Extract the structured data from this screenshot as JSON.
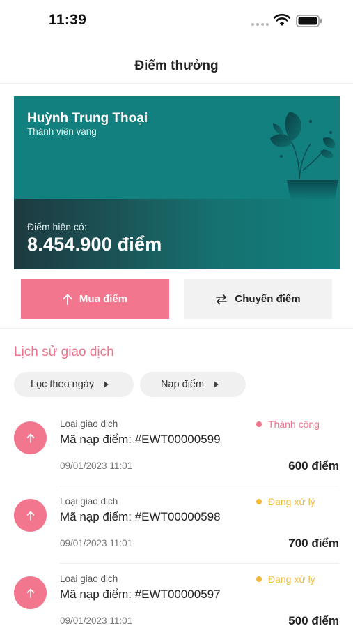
{
  "status_bar": {
    "time": "11:39"
  },
  "header": {
    "title": "Điểm thưởng"
  },
  "card": {
    "name": "Huỳnh Trung Thoại",
    "tier": "Thành viên vàng",
    "points_label": "Điểm hiện có:",
    "points_value": "8.454.900 điểm"
  },
  "actions": {
    "buy_label": "Mua điểm",
    "transfer_label": "Chuyển điểm"
  },
  "history": {
    "title": "Lịch sử giao dịch",
    "filters": [
      {
        "label": "Lọc theo ngày"
      },
      {
        "label": "Nạp điểm"
      }
    ],
    "transactions": [
      {
        "type": "Loại giao dịch",
        "code": "Mã nạp điểm: #EWT00000599",
        "date": "09/01/2023 11:01",
        "amount": "600 điểm",
        "status": "Thành công",
        "status_color": "#f0718a"
      },
      {
        "type": "Loại giao dịch",
        "code": "Mã nạp điểm: #EWT00000598",
        "date": "09/01/2023 11:01",
        "amount": "700 điểm",
        "status": "Đang xử lý",
        "status_color": "#f0b93a"
      },
      {
        "type": "Loại giao dịch",
        "code": "Mã nạp điểm: #EWT00000597",
        "date": "09/01/2023 11:01",
        "amount": "500 điểm",
        "status": "Đang xử lý",
        "status_color": "#f0b93a"
      }
    ]
  },
  "colors": {
    "accent": "#f2768d",
    "card": "#11807e",
    "success": "#f0718a",
    "pending": "#f0b93a"
  }
}
